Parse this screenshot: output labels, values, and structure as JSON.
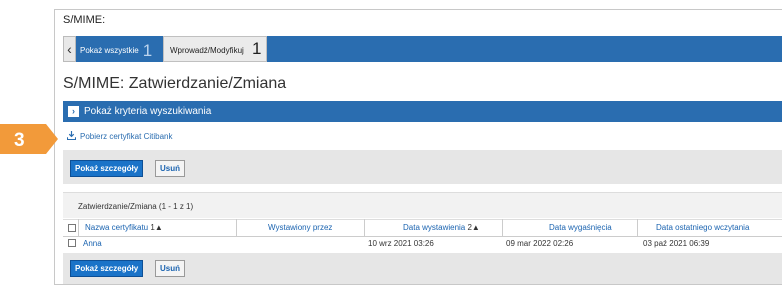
{
  "callout": {
    "number": "3",
    "color": "#f29a3a"
  },
  "header": {
    "title": "S/MIME:"
  },
  "tabs": [
    {
      "label": "Pokaż wszystkie",
      "count": "1"
    },
    {
      "label": "Wprowadź/Modyfikuj",
      "count": "1"
    }
  ],
  "page": {
    "title": "S/MIME: Zatwierdzanie/Zmiana"
  },
  "criteria": {
    "label": "Pokaż kryteria wyszukiwania"
  },
  "download": {
    "label": "Pobierz certyfikat Citibank",
    "icon": "download-icon"
  },
  "actions": {
    "details_label": "Pokaż szczegóły",
    "delete_label": "Usuń"
  },
  "grid": {
    "caption": "Zatwierdzanie/Zmiana (1 - 1 z 1)",
    "columns": [
      {
        "label": "Nazwa certyfikatu",
        "sort": "1▲"
      },
      {
        "label": "Wystawiony przez",
        "sort": ""
      },
      {
        "label": "Data wystawienia",
        "sort": "2▲"
      },
      {
        "label": "Data wygaśnięcia",
        "sort": ""
      },
      {
        "label": "Data ostatniego wczytania",
        "sort": ""
      }
    ],
    "rows": [
      {
        "name": "Anna",
        "issuer": "",
        "issued": "10 wrz 2021 03:26",
        "expires": "09 mar 2022 02:26",
        "last_loaded": "03 paź 2021 06:39"
      }
    ]
  },
  "colors": {
    "accent": "#2a6db0",
    "button": "#1a73c8"
  }
}
